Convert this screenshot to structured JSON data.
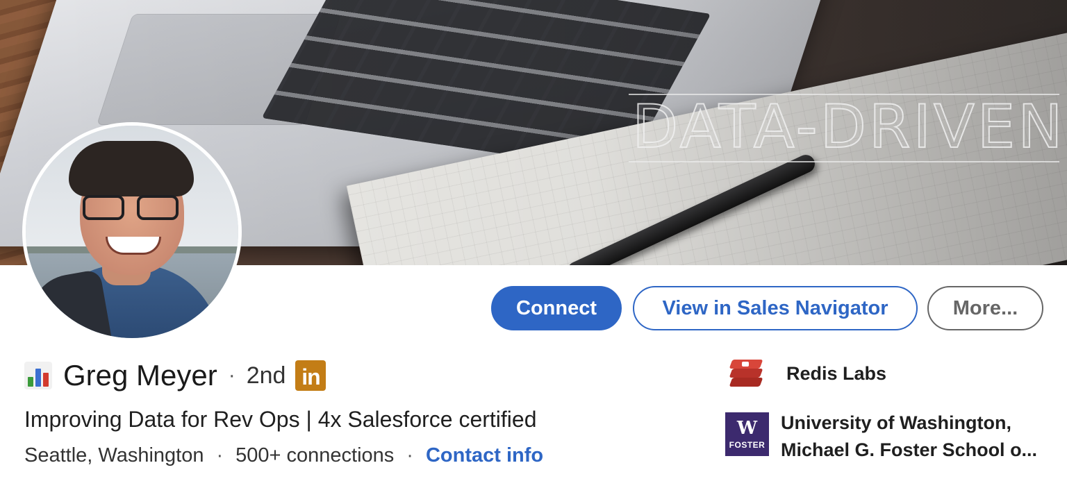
{
  "banner": {
    "overlay_text": "DATA-DRIVEN",
    "description_icon": "laptop-notebook-pen-photo"
  },
  "profile": {
    "avatar_icon": "profile-photo",
    "name_prefix_icon": "bar-chart-emoji",
    "name": "Greg Meyer",
    "separator": "·",
    "degree": "2nd",
    "linkedin_badge": "in",
    "headline": "Improving Data for Rev Ops | 4x Salesforce certified",
    "location": "Seattle, Washington",
    "connections": "500+ connections",
    "contact_link": "Contact info"
  },
  "actions": {
    "connect_label": "Connect",
    "sales_navigator_label": "View in Sales Navigator",
    "more_label": "More..."
  },
  "orgs": {
    "company": {
      "name": "Redis Labs",
      "logo_icon": "redis-logo"
    },
    "school": {
      "line1": "University of Washington,",
      "line2": "Michael G. Foster School o...",
      "logo_text_top": "W",
      "logo_text_bottom": "FOSTER",
      "logo_icon": "uw-foster-logo"
    }
  },
  "colors": {
    "primary_blue": "#2e66c5",
    "linkedin_badge_gold": "#c37d16",
    "redis_red": "#c8372d",
    "uw_purple": "#3c2a6e",
    "muted_gray": "#666666"
  }
}
